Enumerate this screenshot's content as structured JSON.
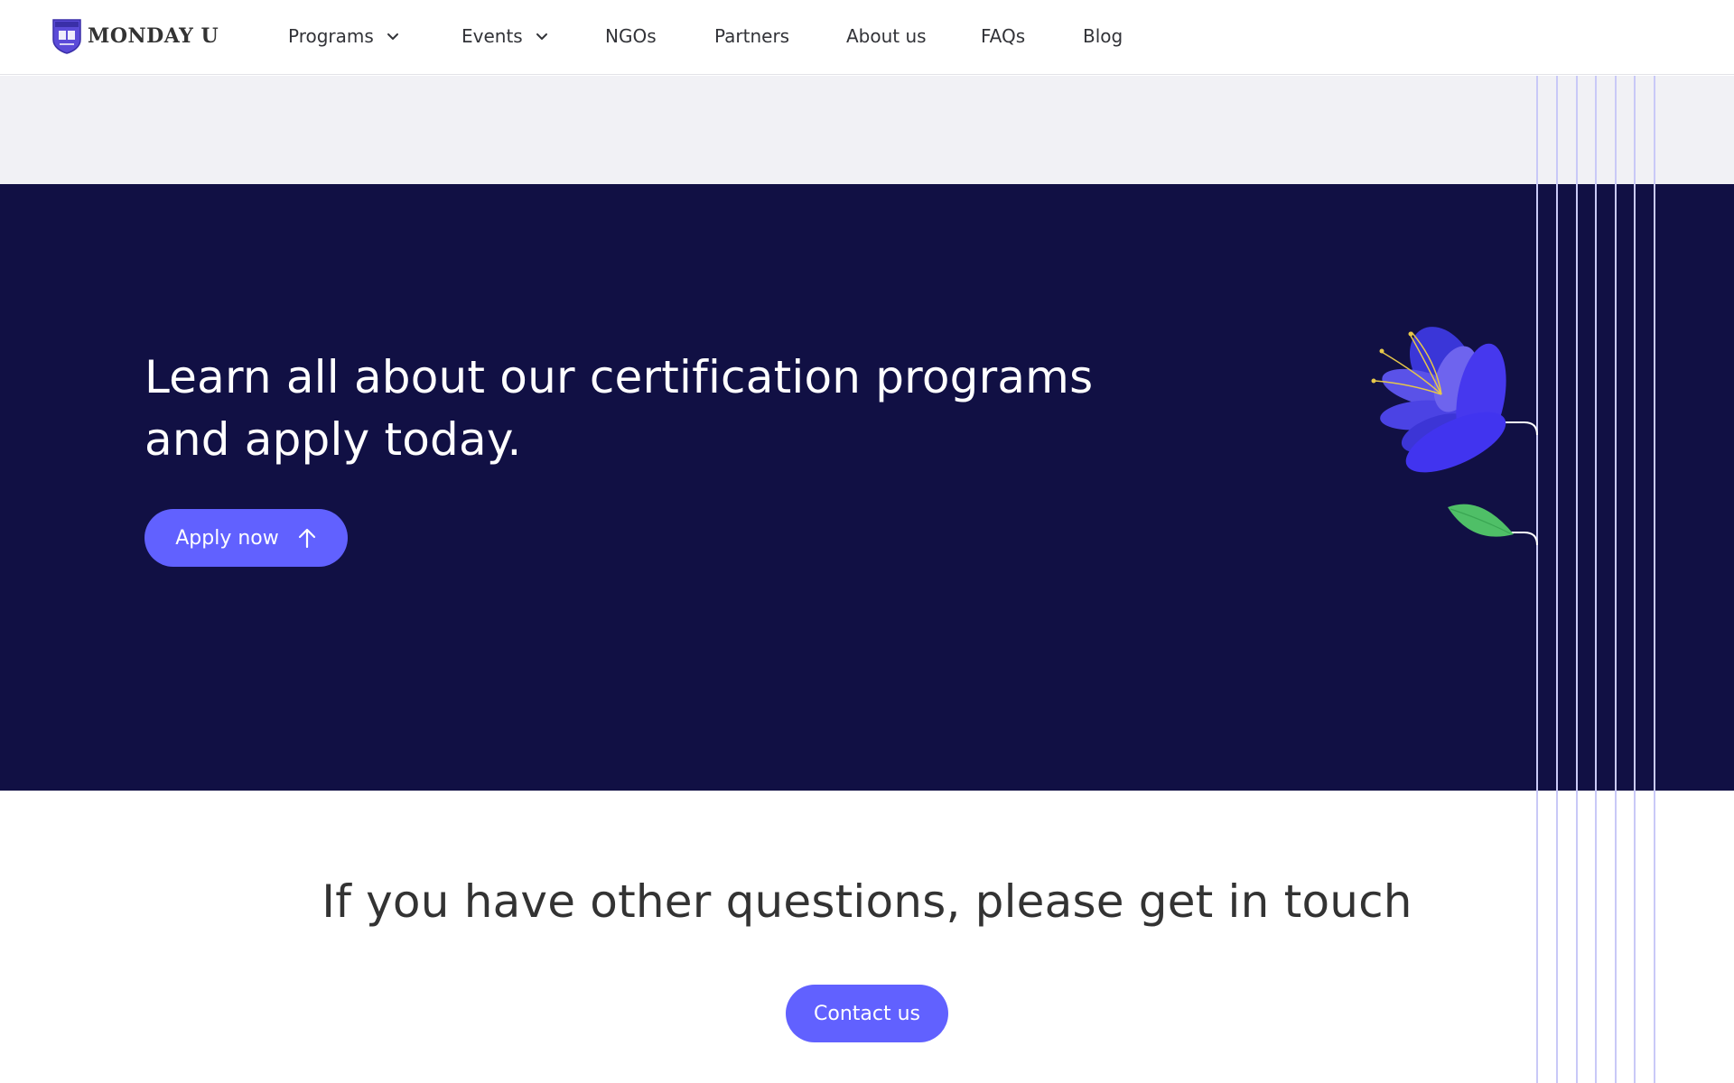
{
  "header": {
    "logo_text": "MONDAY U",
    "logo_badge_text": "MONDAY U",
    "nav": [
      {
        "label": "Programs",
        "has_dropdown": true
      },
      {
        "label": "Events",
        "has_dropdown": true
      },
      {
        "label": "NGOs",
        "has_dropdown": false
      },
      {
        "label": "Partners",
        "has_dropdown": false
      },
      {
        "label": "About us",
        "has_dropdown": false
      },
      {
        "label": "FAQs",
        "has_dropdown": false
      },
      {
        "label": "Blog",
        "has_dropdown": false
      }
    ]
  },
  "hero": {
    "title_line1": "Learn all about our certification programs",
    "title_line2": "and apply today.",
    "apply_button": "Apply now",
    "apply_icon": "arrow-up-icon"
  },
  "contact": {
    "title": "If you have other questions, please get in touch",
    "button": "Contact us"
  },
  "colors": {
    "accent": "#6161ff",
    "hero_background": "#111044",
    "strip_background": "#f1f1f5",
    "flower": "#4a3ce8",
    "leaf": "#4fbf67",
    "deco_lines": "#c9c9f7"
  },
  "icons": [
    "monday-u-shield-icon",
    "chevron-down-icon",
    "arrow-up-icon",
    "flower-illustration",
    "leaf-illustration"
  ]
}
